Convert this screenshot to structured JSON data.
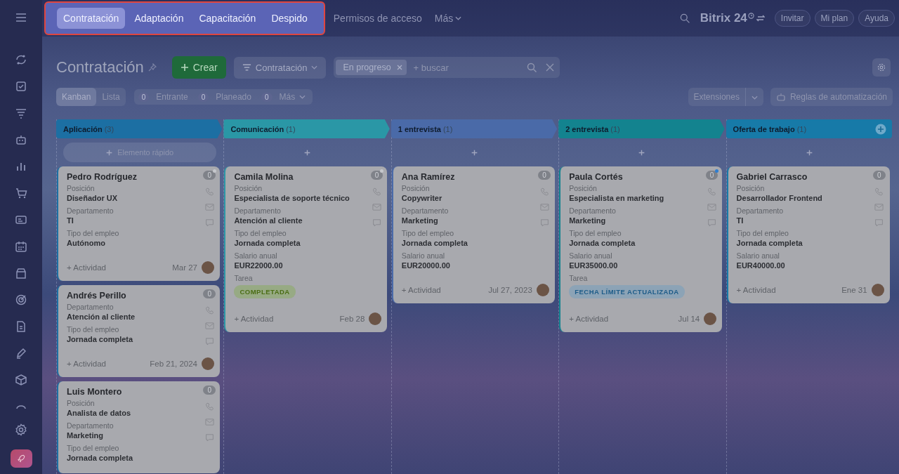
{
  "top_nav": {
    "highlighted": [
      {
        "label": "Contratación",
        "selected": true
      },
      {
        "label": "Adaptación",
        "selected": false
      },
      {
        "label": "Capacitación",
        "selected": false
      },
      {
        "label": "Despido",
        "selected": false
      }
    ],
    "others": [
      {
        "label": "Permisos de acceso",
        "kind": "link"
      },
      {
        "label": "Más",
        "kind": "dropdown"
      }
    ]
  },
  "header": {
    "logo": "Bitrix 24",
    "buttons": [
      "Invitar",
      "Mi plan",
      "Ayuda"
    ]
  },
  "page": {
    "title": "Contratación",
    "create_button": "Crear",
    "pipeline": "Contratación",
    "filter": {
      "chips": [
        "En progreso"
      ],
      "placeholder": "+ buscar"
    }
  },
  "views": [
    {
      "label": "Kanban",
      "selected": true
    },
    {
      "label": "Lista",
      "selected": false
    }
  ],
  "counters": [
    {
      "count": "0",
      "label": "Entrante",
      "kind": "plain"
    },
    {
      "count": "0",
      "label": "Planeado",
      "kind": "plain"
    },
    {
      "count": "0",
      "label": "Más",
      "kind": "dropdown"
    }
  ],
  "extensions": "Extensiones",
  "automation": "Reglas de automatización",
  "columns": [
    {
      "title": "Aplicación",
      "count": "(3)",
      "color": "#1c6fa3",
      "quick_add": "Elemento rápido",
      "cards": [
        {
          "name": "Pedro Rodríguez",
          "count": "0",
          "unread": true,
          "fields": [
            {
              "label": "Posición",
              "value": "Diseñador UX"
            },
            {
              "label": "Departamento",
              "value": "TI"
            },
            {
              "label": "Tipo del empleo",
              "value": "Autónomo"
            }
          ],
          "activity": "+ Actividad",
          "date": "Mar 27"
        },
        {
          "name": "Andrés Perillo",
          "count": "0",
          "unread": false,
          "fields": [
            {
              "label": "Departamento",
              "value": "Atención al cliente"
            },
            {
              "label": "Tipo del empleo",
              "value": "Jornada completa"
            }
          ],
          "activity": "+ Actividad",
          "date": "Feb 21, 2024"
        },
        {
          "name": "Luis Montero",
          "count": "0",
          "unread": false,
          "fields": [
            {
              "label": "Posición",
              "value": "Analista de datos"
            },
            {
              "label": "Departamento",
              "value": "Marketing"
            },
            {
              "label": "Tipo del empleo",
              "value": "Jornada completa"
            }
          ]
        }
      ]
    },
    {
      "title": "Comunicación",
      "count": "(1)",
      "color": "#2a97a6",
      "cards": [
        {
          "name": "Camila Molina",
          "count": "0",
          "unread": true,
          "fields": [
            {
              "label": "Posición",
              "value": "Especialista de soporte técnico"
            },
            {
              "label": "Departamento",
              "value": "Atención al cliente"
            },
            {
              "label": "Tipo del empleo",
              "value": "Jornada completa"
            },
            {
              "label": "Salario anual",
              "value": "EUR22000.00"
            }
          ],
          "task": {
            "label": "Tarea",
            "status": "COMPLETADA",
            "kind": "success"
          },
          "activity": "+ Actividad",
          "date": "Feb 28"
        }
      ]
    },
    {
      "title": "1 entrevista",
      "count": "(1)",
      "color": "#4a6aa8",
      "cards": [
        {
          "name": "Ana Ramírez",
          "count": "0",
          "unread": false,
          "fields": [
            {
              "label": "Posición",
              "value": "Copywriter"
            },
            {
              "label": "Departamento",
              "value": "Marketing"
            },
            {
              "label": "Tipo del empleo",
              "value": "Jornada completa"
            },
            {
              "label": "Salario anual",
              "value": "EUR20000.00"
            }
          ],
          "activity": "+ Actividad",
          "date": "Jul 27, 2023"
        }
      ]
    },
    {
      "title": "2 entrevista",
      "count": "(1)",
      "color": "#13838f",
      "cards": [
        {
          "name": "Paula Cortés",
          "count": "0",
          "unread": true,
          "fields": [
            {
              "label": "Posición",
              "value": "Especialista en marketing"
            },
            {
              "label": "Departamento",
              "value": "Marketing"
            },
            {
              "label": "Tipo del empleo",
              "value": "Jornada completa"
            },
            {
              "label": "Salario anual",
              "value": "EUR35000.00"
            }
          ],
          "task": {
            "label": "Tarea",
            "status": "FECHA LÍMITE ACTUALIZADA",
            "kind": "info"
          },
          "activity": "+ Actividad",
          "date": "Jul 14"
        }
      ]
    },
    {
      "title": "Oferta de trabajo",
      "count": "(1)",
      "color": "#177aa8",
      "cards": [
        {
          "name": "Gabriel Carrasco",
          "count": "0",
          "unread": false,
          "fields": [
            {
              "label": "Posición",
              "value": "Desarrollador Frontend"
            },
            {
              "label": "Departamento",
              "value": "TI"
            },
            {
              "label": "Tipo del empleo",
              "value": "Jornada completa"
            },
            {
              "label": "Salario anual",
              "value": "EUR40000.00"
            }
          ],
          "activity": "+ Actividad",
          "date": "Ene 31"
        }
      ]
    }
  ]
}
